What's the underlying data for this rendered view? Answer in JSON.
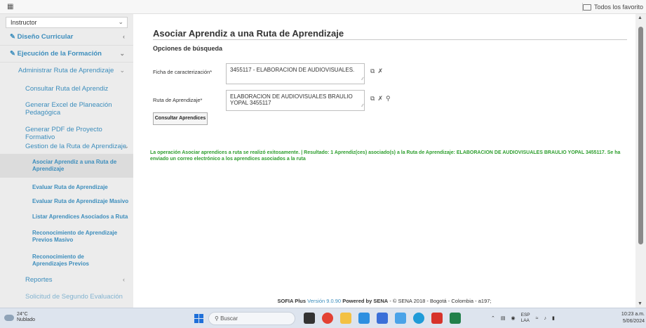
{
  "browser": {
    "favorites_label": "Todos los favorito"
  },
  "sidebar": {
    "role_select": "Instructor",
    "items": [
      {
        "label": "Diseño Curricular"
      },
      {
        "label": "Ejecución de la Formación"
      },
      {
        "label": "Administrar Ruta de Aprendizaje"
      },
      {
        "label": "Consultar Ruta del Aprendiz"
      },
      {
        "label": "Generar Excel de Planeación Pedagógica"
      },
      {
        "label": "Generar PDF de Proyecto Formativo"
      },
      {
        "label": "Gestion de la Ruta de Aprendizaje"
      },
      {
        "label": "Asociar Aprendiz a una Ruta de Aprendizaje"
      },
      {
        "label": "Evaluar Ruta de Aprendizaje"
      },
      {
        "label": "Evaluar Ruta de Aprendizaje Masivo"
      },
      {
        "label": "Listar Aprendices Asociados a Ruta"
      },
      {
        "label": "Reconocimiento de Aprendizaje Previos Masivo"
      },
      {
        "label": "Reconocimiento de Aprendizajes Previos"
      },
      {
        "label": "Reportes"
      },
      {
        "label": "Solicitud de Segundo Evaluación"
      }
    ]
  },
  "main": {
    "title": "Asociar Aprendiz a una Ruta de Aprendizaje",
    "subtitle": "Opciones de búsqueda",
    "ficha_label": "Ficha de caracterización*",
    "ficha_value": "3455117 - ELABORACION DE AUDIOVISUALES.",
    "ruta_label": "Ruta de Aprendizaje*",
    "ruta_value": "ELABORACION DE AUDIOVISUALES BRAULIO YOPAL 3455117",
    "consult_button": "Consultar Aprendices",
    "success_message": "La operación Asociar aprendices a ruta se realizó exitosamente. | Resultado: 1 Aprendiz(ces) asociado(s) a la Ruta de Aprendizaje: ELABORACION DE AUDIOVISUALES BRAULIO YOPAL 3455117. Se ha enviado un correo electrónico a los aprendices asociados a la ruta"
  },
  "footer": {
    "prefix": "SOFIA Plus",
    "version_text": "Versión 9.0.90",
    "powered": "Powered by SENA",
    "rest": "- © SENA 2018 - Bogotá - Colombia - a197;"
  },
  "taskbar": {
    "temperature": "24°C",
    "weather": "Nublado",
    "search_placeholder": "Buscar",
    "lang_line1": "ESP",
    "lang_line2": "LAA",
    "time": "10:23 a.m.",
    "date": "5/06/2024"
  },
  "colors": {
    "link": "#3c8dbc",
    "success": "#2e9e2e"
  }
}
